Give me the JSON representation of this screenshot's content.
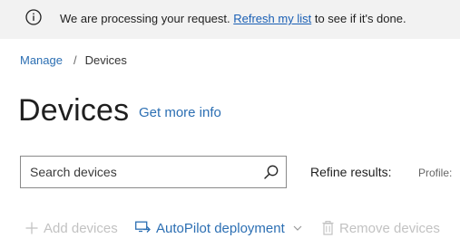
{
  "banner": {
    "text_before": "We are processing your request. ",
    "link": "Refresh my list",
    "text_after": " to see if it's done."
  },
  "breadcrumb": {
    "parent": "Manage",
    "separator": "/",
    "current": "Devices"
  },
  "header": {
    "title": "Devices",
    "info_link": "Get more info"
  },
  "search": {
    "placeholder": "Search devices",
    "value": ""
  },
  "filters": {
    "refine_label": "Refine results:",
    "profile_label": "Profile:"
  },
  "toolbar": {
    "add_label": "Add devices",
    "autopilot_label": "AutoPilot deployment",
    "remove_label": "Remove devices"
  },
  "colors": {
    "link": "#2c6fb3",
    "disabled": "#c2c2c2",
    "banner_bg": "#f2f2f2"
  }
}
